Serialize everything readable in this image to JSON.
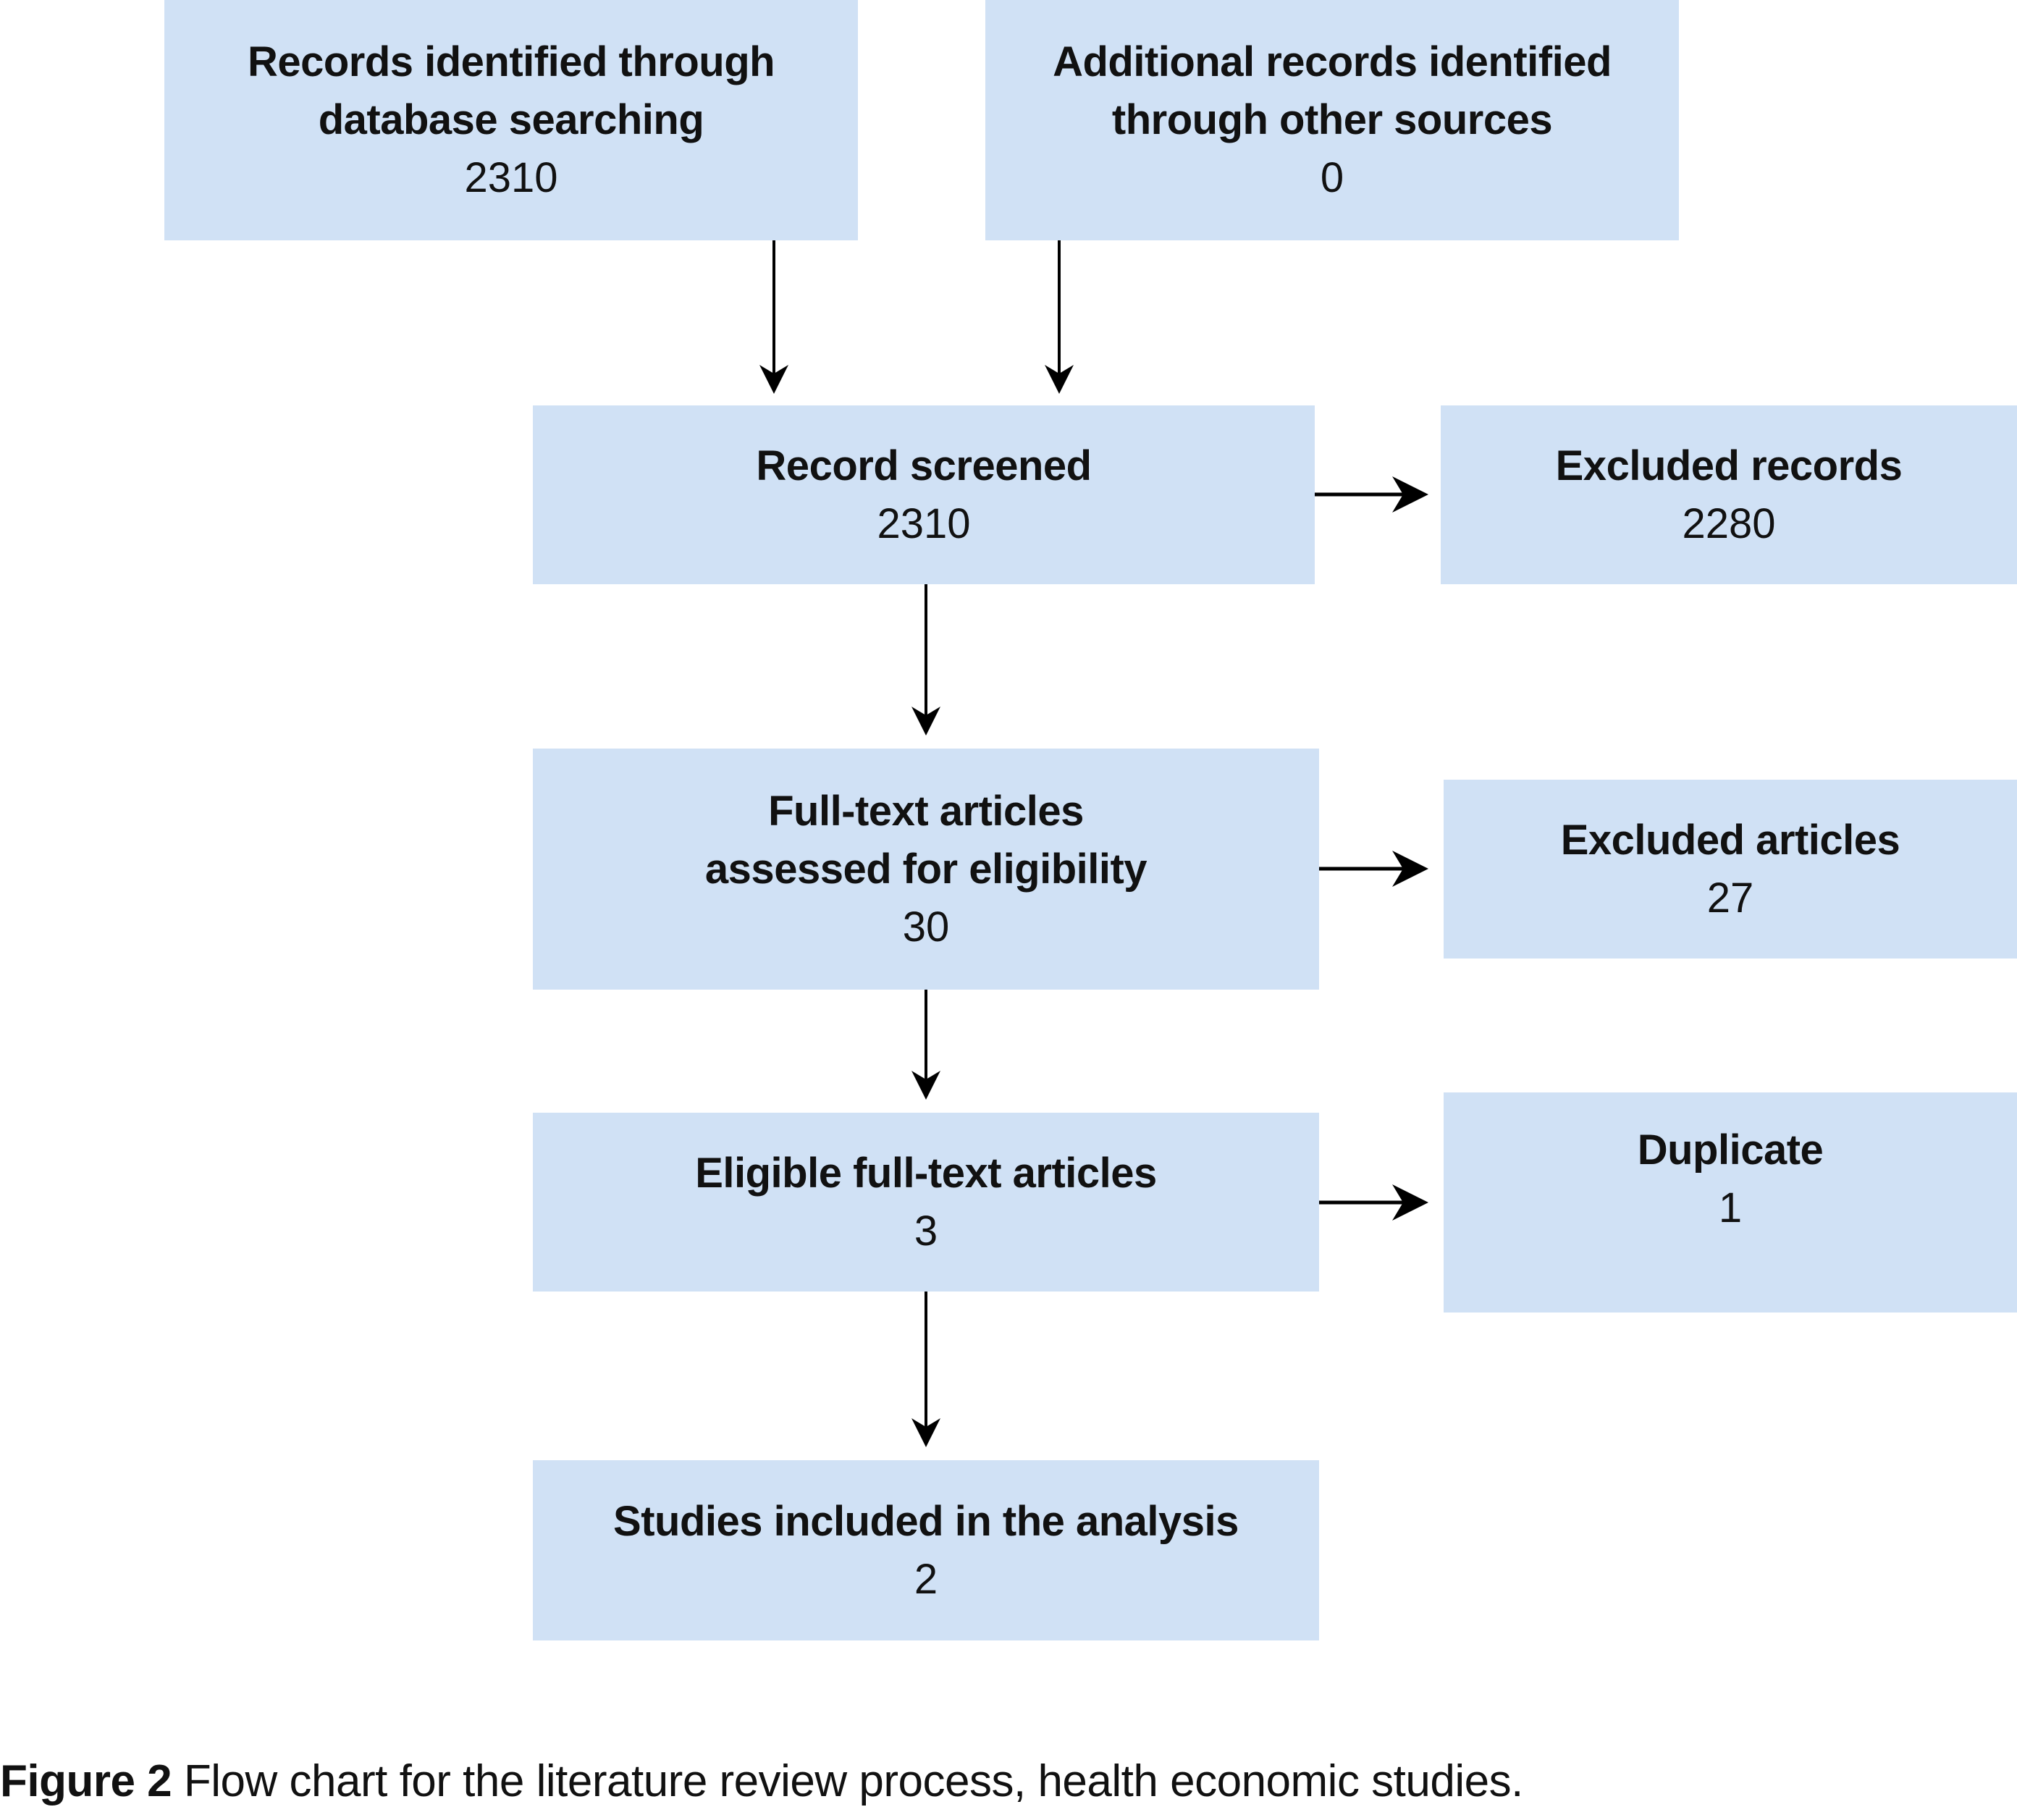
{
  "colors": {
    "box_fill": "#d0e1f5",
    "arrow": "#000000",
    "text": "#111111"
  },
  "boxes": {
    "database": {
      "title_lines": [
        "Records identified through",
        "database searching"
      ],
      "count": "2310"
    },
    "other_sources": {
      "title_lines": [
        "Additional records identified",
        "through other sources"
      ],
      "count": "0"
    },
    "screened": {
      "title_lines": [
        "Record screened"
      ],
      "count": "2310"
    },
    "excluded_records": {
      "title_lines": [
        "Excluded records"
      ],
      "count": "2280"
    },
    "fulltext": {
      "title_lines": [
        "Full-text articles",
        "assessed for eligibility"
      ],
      "count": "30"
    },
    "excluded_articles": {
      "title_lines": [
        "Excluded articles"
      ],
      "count": "27"
    },
    "eligible": {
      "title_lines": [
        "Eligible full-text articles"
      ],
      "count": "3"
    },
    "duplicate": {
      "title_lines": [
        "Duplicate"
      ],
      "count": "1"
    },
    "included": {
      "title_lines": [
        "Studies included in the analysis"
      ],
      "count": "2"
    }
  },
  "edges": [
    {
      "from": "database",
      "to": "screened"
    },
    {
      "from": "other_sources",
      "to": "screened"
    },
    {
      "from": "screened",
      "to": "excluded_records"
    },
    {
      "from": "screened",
      "to": "fulltext"
    },
    {
      "from": "fulltext",
      "to": "excluded_articles"
    },
    {
      "from": "fulltext",
      "to": "eligible"
    },
    {
      "from": "eligible",
      "to": "duplicate"
    },
    {
      "from": "eligible",
      "to": "included"
    }
  ],
  "caption": {
    "label": "Figure 2",
    "text": " Flow chart for the literature review process, health economic studies."
  }
}
